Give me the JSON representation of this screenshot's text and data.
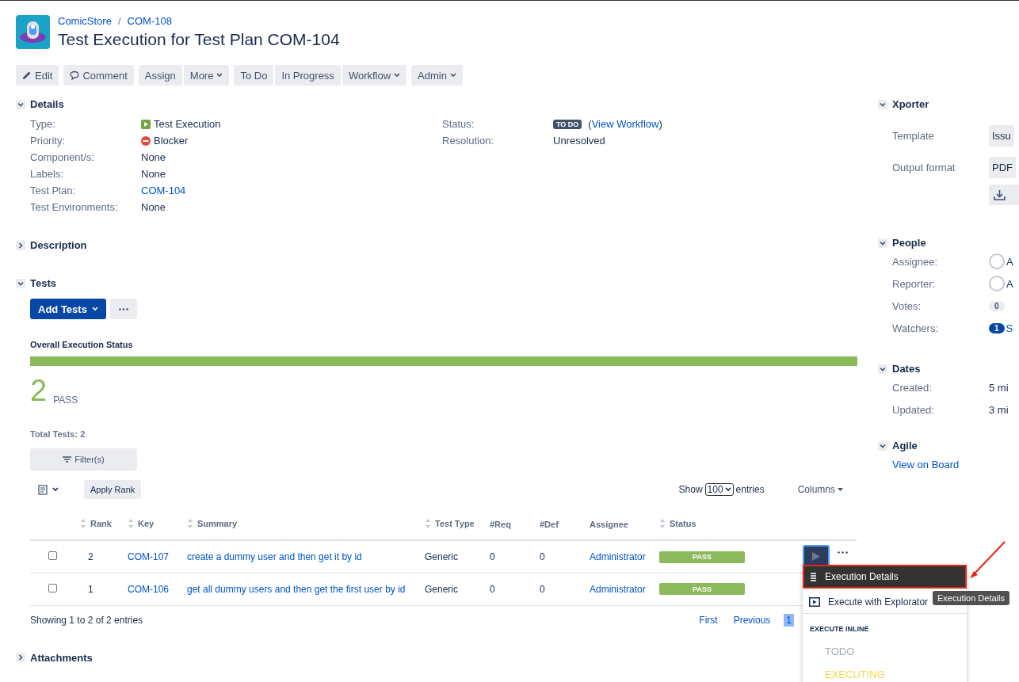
{
  "header": {
    "project": "ComicStore",
    "separator": "/",
    "issue_key": "COM-108",
    "title": "Test Execution for Test Plan COM-104"
  },
  "toolbar": [
    [
      {
        "label": "Edit",
        "kind": "edit",
        "dropdown": false
      }
    ],
    [
      {
        "label": "Comment",
        "kind": "comment",
        "dropdown": false
      }
    ],
    [
      {
        "label": "Assign",
        "dropdown": false
      },
      {
        "label": "More",
        "dropdown": true
      }
    ],
    [
      {
        "label": "To Do",
        "dropdown": false
      },
      {
        "label": "In Progress",
        "dropdown": false
      },
      {
        "label": "Workflow",
        "dropdown": true
      }
    ],
    [
      {
        "label": "Admin",
        "dropdown": true
      }
    ]
  ],
  "details": {
    "title": "Details",
    "expanded": true,
    "left": [
      {
        "label": "Type:",
        "value": "Test Execution",
        "kind": "type"
      },
      {
        "label": "Priority:",
        "value": "Blocker",
        "kind": "priority"
      },
      {
        "label": "Component/s:",
        "value": "None",
        "kind": "text"
      },
      {
        "label": "Labels:",
        "value": "None",
        "kind": "text"
      },
      {
        "label": "Test Plan:",
        "value": "COM-104",
        "kind": "link"
      },
      {
        "label": "Test Environments:",
        "value": "None",
        "kind": "text"
      }
    ],
    "right": [
      {
        "label": "Status:",
        "kind": "status",
        "badge": "TO DO",
        "link_prefix": "(",
        "link": "View Workflow",
        "link_suffix": ")"
      },
      {
        "label": "Resolution:",
        "value": "Unresolved",
        "kind": "text"
      }
    ]
  },
  "description": {
    "title": "Description",
    "expanded": false
  },
  "tests": {
    "title": "Tests",
    "expanded": true,
    "add_button": "Add Tests",
    "overall_title": "Overall Execution Status",
    "level": 1,
    "count": "2",
    "count_label": "PASS",
    "total": "Total Tests: 2",
    "filter": "Filter(s)",
    "apply_rank": "Apply Rank",
    "show": "Show",
    "page_size": "100",
    "entries": "entries",
    "columns_button": "Columns",
    "columns": [
      {
        "label": "Rank",
        "sortable": true
      },
      {
        "label": "Key",
        "sortable": true
      },
      {
        "label": "Summary",
        "sortable": true
      },
      {
        "label": "Test Type",
        "sortable": true
      },
      {
        "label": "#Req",
        "sortable": false
      },
      {
        "label": "#Def",
        "sortable": false
      },
      {
        "label": "Assignee",
        "sortable": false
      },
      {
        "label": "Status",
        "sortable": true
      }
    ],
    "rows": [
      {
        "checked": false,
        "rank": "2",
        "key": "COM-107",
        "summary": "create a dummy user and then get it by id",
        "test_type": "Generic",
        "req": "0",
        "def": "0",
        "assignee": "Administrator",
        "status": "PASS",
        "kind": "pass"
      },
      {
        "checked": false,
        "rank": "1",
        "key": "COM-106",
        "summary": "get all dummy users and then get the first user by id",
        "test_type": "Generic",
        "req": "0",
        "def": "0",
        "assignee": "Administrator",
        "status": "PASS",
        "kind": "pass"
      }
    ],
    "showing": "Showing 1 to 2 of 2 entries",
    "pagination": [
      {
        "label": "First",
        "selected": false
      },
      {
        "label": "Previous",
        "selected": false
      },
      {
        "label": "1",
        "selected": true
      }
    ]
  },
  "attachments": {
    "title": "Attachments",
    "expanded": false
  },
  "menu": {
    "items": [
      {
        "label": "Execution Details",
        "kind": "details",
        "highlighted": true
      },
      {
        "label": "Execute with Explorator",
        "kind": "explore",
        "highlighted": false
      }
    ],
    "section": "EXECUTE INLINE",
    "statuses": [
      {
        "label": "TODO",
        "color": "#a5adba"
      },
      {
        "label": "EXECUTING",
        "color": "#f1d54b"
      }
    ]
  },
  "tooltip": "Execution Details",
  "sidebar": {
    "xporter": {
      "title": "Xporter",
      "expanded": true,
      "rows": [
        {
          "label": "Template",
          "value": "Issu"
        },
        {
          "label": "Output format",
          "value": "PDF"
        }
      ]
    },
    "people": {
      "title": "People",
      "expanded": true,
      "rows": [
        {
          "label": "Assignee:",
          "kind": "user",
          "value": "A"
        },
        {
          "label": "Reporter:",
          "kind": "user",
          "value": "A"
        },
        {
          "label": "Votes:",
          "kind": "votes",
          "count": "0"
        },
        {
          "label": "Watchers:",
          "kind": "watchers",
          "count": "1",
          "value": "S"
        }
      ]
    },
    "dates": {
      "title": "Dates",
      "expanded": true,
      "rows": [
        {
          "label": "Created:",
          "value": "5 mi"
        },
        {
          "label": "Updated:",
          "value": "3 mi"
        }
      ]
    },
    "agile": {
      "title": "Agile",
      "expanded": true,
      "link": "View on Board"
    }
  }
}
